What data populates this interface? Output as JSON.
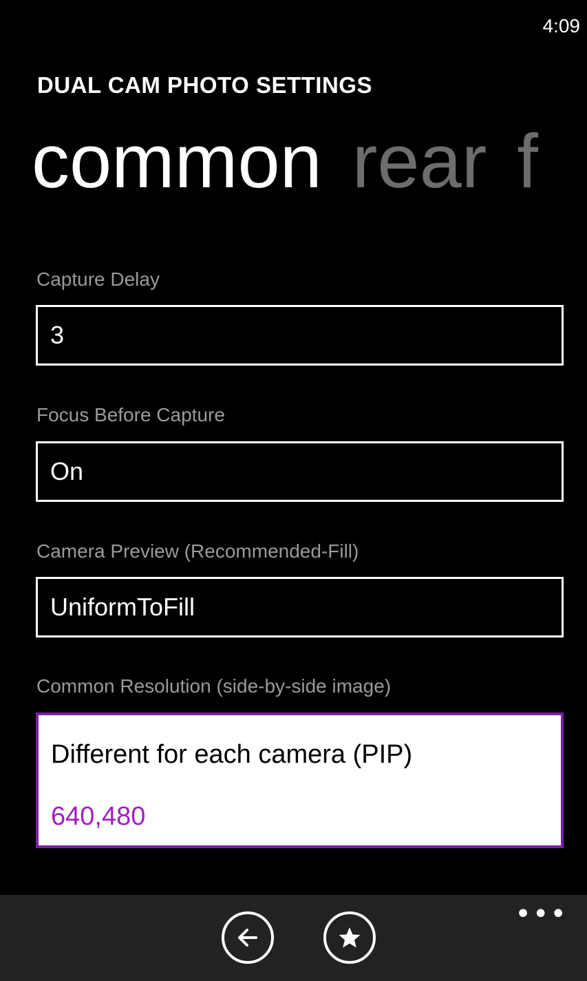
{
  "status_bar": {
    "time": "4:09"
  },
  "app": {
    "title": "DUAL CAM PHOTO SETTINGS"
  },
  "pivot": {
    "tabs": [
      {
        "label": "common",
        "active": true
      },
      {
        "label": "rear",
        "active": false
      },
      {
        "label": "f",
        "active": false
      }
    ]
  },
  "settings": {
    "capture_delay": {
      "label": "Capture Delay",
      "value": "3"
    },
    "focus_before_capture": {
      "label": "Focus Before Capture",
      "value": "On"
    },
    "camera_preview": {
      "label": "Camera Preview (Recommended-Fill)",
      "value": "UniformToFill"
    },
    "common_resolution": {
      "label": "Common Resolution (side-by-side image)",
      "option_label": "Different for each camera (PIP)",
      "option_value": "640,480"
    }
  },
  "app_bar": {
    "buttons": [
      {
        "icon": "back-arrow-icon"
      },
      {
        "icon": "star-icon"
      }
    ],
    "more_label": "•••"
  },
  "colors": {
    "background": "#000000",
    "accent": "#a020c0",
    "inactive_tab": "#6d6d6d",
    "label": "#9a9a9a",
    "app_bar": "#222222"
  }
}
